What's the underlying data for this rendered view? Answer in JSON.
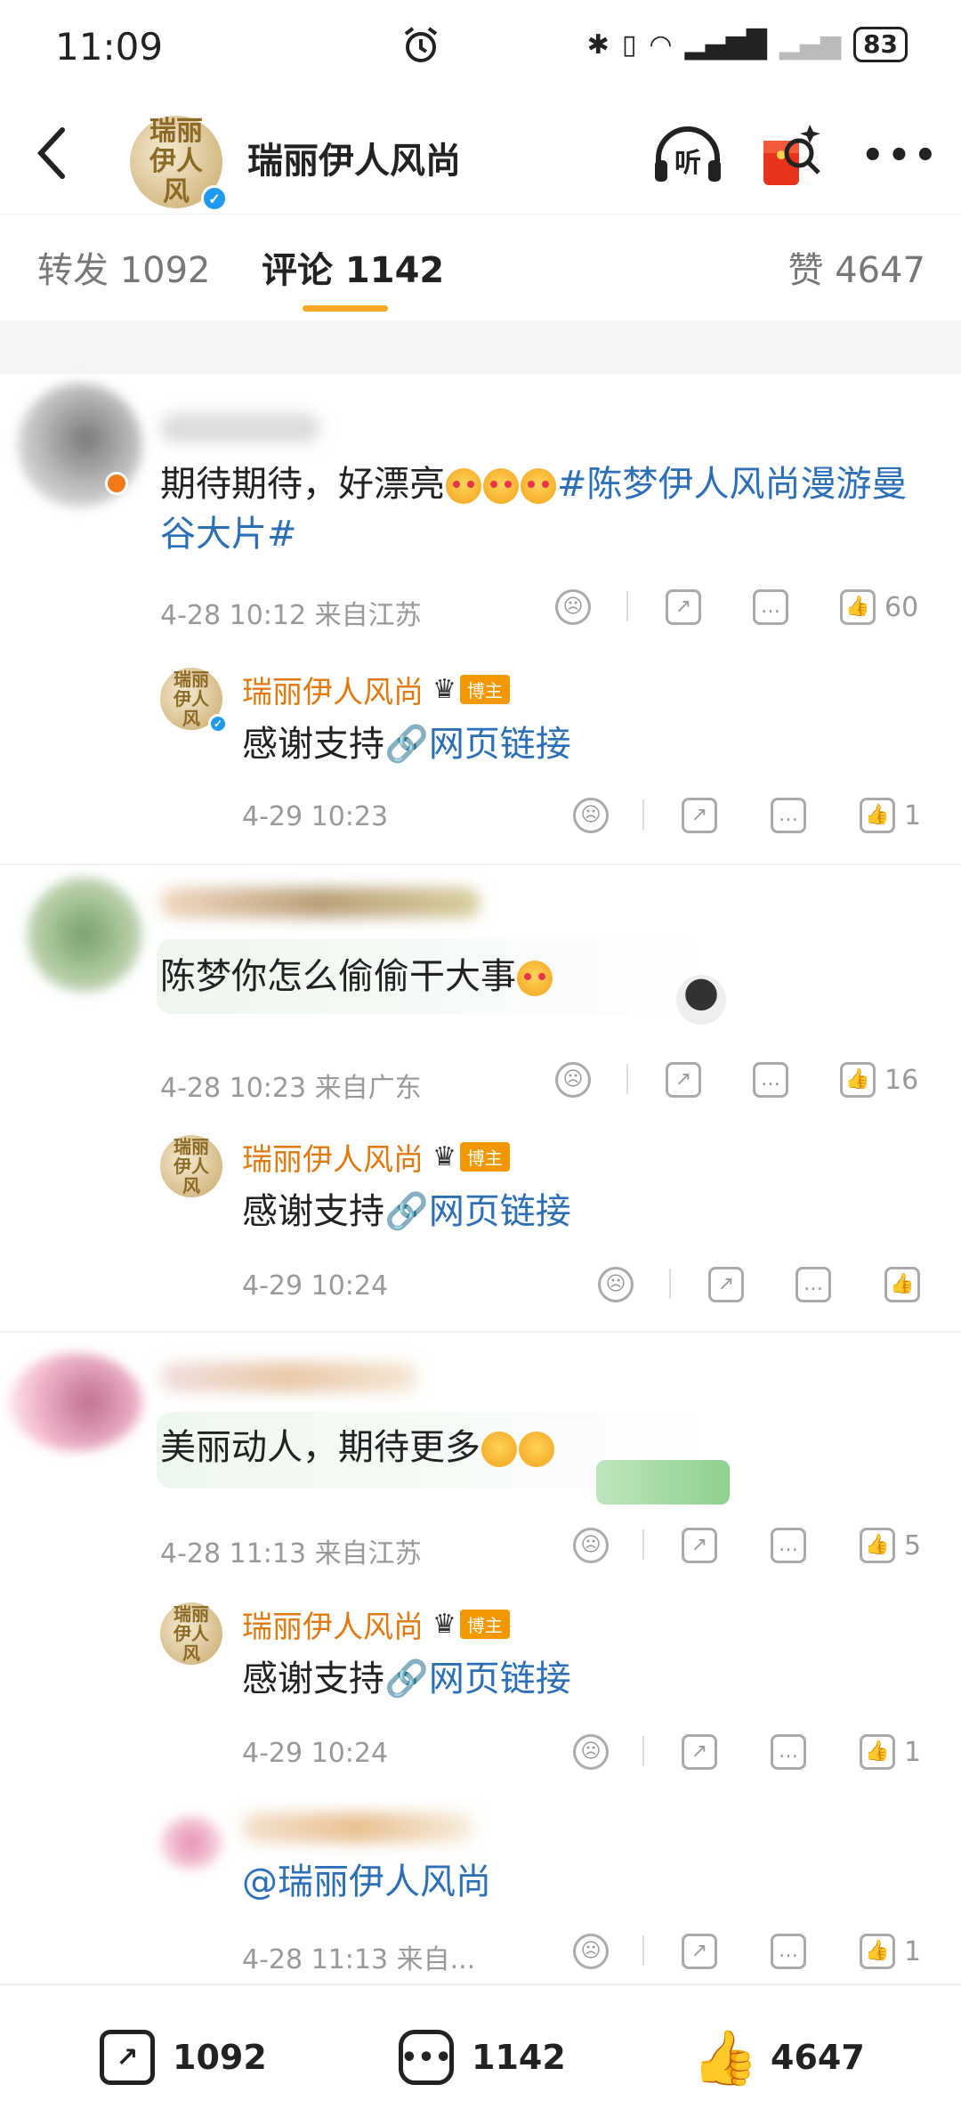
{
  "status_bar": {
    "time": "11:09",
    "battery": "83"
  },
  "header": {
    "title": "瑞丽伊人风尚",
    "back_icon": "chevron-left-icon",
    "listen_label": "听",
    "more_label": "•••",
    "avatar_text": "瑞丽伊人风"
  },
  "tabs": {
    "repost": "转发 1092",
    "comment": "评论 1142",
    "like": "赞 4647"
  },
  "comments": [
    {
      "text_plain": "期待期待，好漂亮",
      "topic": "#陈梦伊人风尚漫游曼谷大片#",
      "time": "4-28 10:12 来自江苏",
      "likes": "60",
      "reply": {
        "name": "瑞丽伊人风尚",
        "badge": "博主",
        "text": "感谢支持",
        "link": "网页链接",
        "time": "4-29 10:23",
        "likes": "1"
      }
    },
    {
      "text_plain": "陈梦你怎么偷偷干大事",
      "time": "4-28 10:23 来自广东",
      "likes": "16",
      "reply": {
        "name": "瑞丽伊人风尚",
        "badge": "博主",
        "text": "感谢支持",
        "link": "网页链接",
        "time": "4-29 10:24",
        "likes": ""
      }
    },
    {
      "text_plain": "美丽动人，期待更多",
      "time": "4-28 11:13 来自江苏",
      "likes": "5",
      "reply": {
        "name": "瑞丽伊人风尚",
        "badge": "博主",
        "text": "感谢支持",
        "link": "网页链接",
        "time": "4-29 10:24",
        "likes": "1"
      },
      "reply2": {
        "text": "@瑞丽伊人风尚",
        "time": "4-28 11:13 来自...",
        "likes": "1"
      }
    }
  ],
  "bottom": {
    "repost": "1092",
    "comment": "1142",
    "like": "4647"
  },
  "colors": {
    "accent": "#f5a623",
    "topic": "#2d6fb7",
    "author": "#e07a10"
  }
}
